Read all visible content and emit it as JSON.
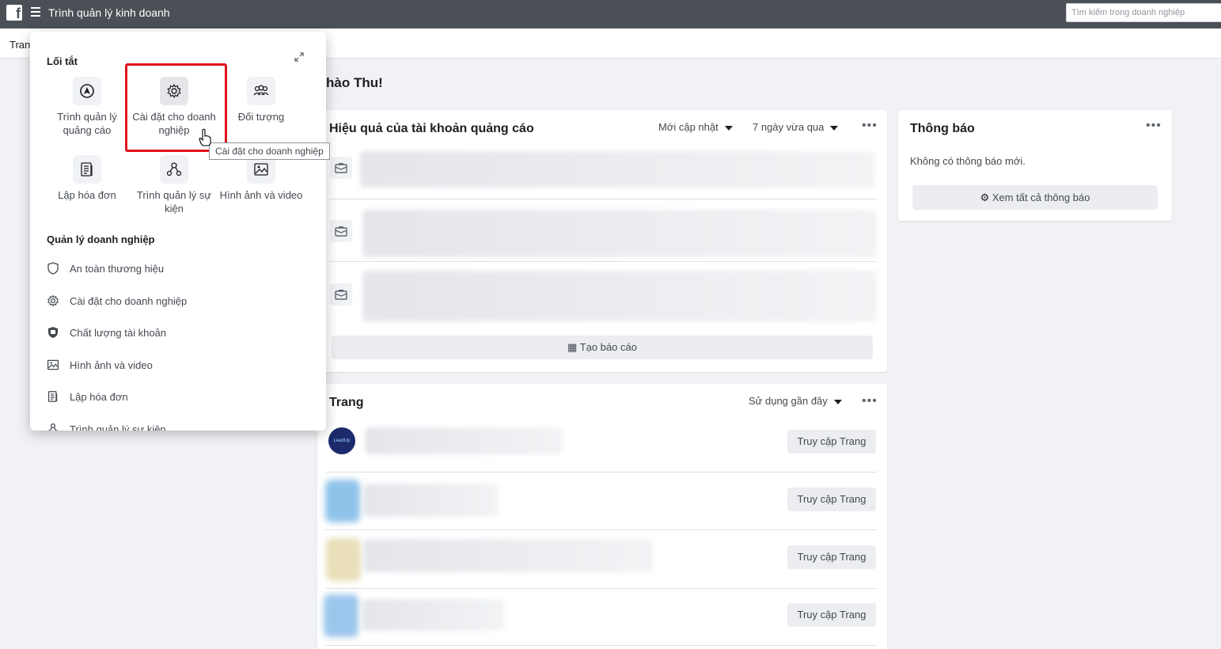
{
  "topbar": {
    "logo": "f",
    "title": "Trình quản lý kinh doanh",
    "search_placeholder": "Tìm kiếm trong doanh nghiệp"
  },
  "subnav": {
    "label": "Tran"
  },
  "greeting": "hào Thu!",
  "ads_card": {
    "title": "Hiệu quả của tài khoản quảng cáo",
    "sort_label": "Mới cập nhật",
    "range_label": "7 ngày vừa qua",
    "create_report": "Tạo báo cáo"
  },
  "notifications_card": {
    "title": "Thông báo",
    "empty_text": "Không có thông báo mới.",
    "view_all": "Xem tất cả thông báo"
  },
  "pages_card": {
    "title": "Trang",
    "sort_label": "Sử dụng gần đây",
    "rows": [
      {
        "button": "Truy cập Trang",
        "avatar_text": "LeadUp",
        "thumb_color": "#1b2a6b"
      },
      {
        "button": "Truy cập Trang",
        "thumb_color": "#8fc3ea"
      },
      {
        "button": "Truy cập Trang",
        "thumb_color": "#e8dfb8"
      },
      {
        "button": "Truy cập Trang",
        "thumb_color": "#9cc6ec"
      }
    ]
  },
  "panel": {
    "shortcuts_heading": "Lối tắt",
    "shortcuts": [
      {
        "label": "Trình quản lý quảng cáo",
        "icon": "navigation-arrow-icon"
      },
      {
        "label": "Cài đặt cho doanh nghiệp",
        "icon": "gear-icon"
      },
      {
        "label": "Đối tượng",
        "icon": "people-group-icon"
      },
      {
        "label": "Lập hóa đơn",
        "icon": "billing-stack-icon"
      },
      {
        "label": "Trình quản lý sự kiện",
        "icon": "event-network-icon"
      },
      {
        "label": "Hình ảnh và video",
        "icon": "image-icon"
      }
    ],
    "business_heading": "Quản lý doanh nghiệp",
    "menu": [
      {
        "label": "An toàn thương hiệu",
        "icon": "shield-icon"
      },
      {
        "label": "Cài đặt cho doanh nghiệp",
        "icon": "gear-icon"
      },
      {
        "label": "Chất lượng tài khoản",
        "icon": "shield-check-icon"
      },
      {
        "label": "Hình ảnh và video",
        "icon": "image-icon"
      },
      {
        "label": "Lập hóa đơn",
        "icon": "billing-stack-icon"
      },
      {
        "label": "Trình quản lý sự kiện",
        "icon": "event-network-icon"
      }
    ]
  },
  "tooltip": "Cài đặt cho doanh nghiệp",
  "colors": {
    "topbar": "#4b4f56",
    "highlight": "#e0121b",
    "background": "#f0f2f5"
  }
}
